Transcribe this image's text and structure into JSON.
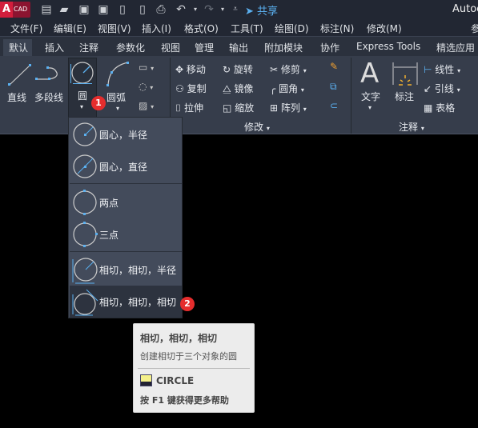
{
  "titlebar": {
    "logo": "CAD",
    "logo_letter": "A",
    "share": "共享",
    "app_title": "Autoc"
  },
  "menu": [
    "文件(F)",
    "编辑(E)",
    "视图(V)",
    "插入(I)",
    "格式(O)",
    "工具(T)",
    "绘图(D)",
    "标注(N)",
    "修改(M)",
    "参"
  ],
  "tabs": [
    "默认",
    "插入",
    "注释",
    "参数化",
    "视图",
    "管理",
    "输出",
    "附加模块",
    "协作",
    "Express Tools",
    "精选应用"
  ],
  "draw": {
    "line": "直线",
    "polyline": "多段线",
    "circle": "圆",
    "arc": "圆弧"
  },
  "modify": {
    "move": "移动",
    "rotate": "旋转",
    "trim": "修剪",
    "copy": "复制",
    "mirror": "镜像",
    "fillet": "圆角",
    "stretch": "拉伸",
    "scale": "缩放",
    "array": "阵列",
    "title": "修改"
  },
  "annotation": {
    "text": "文字",
    "dimension": "标注",
    "linear": "线性",
    "leader": "引线",
    "table": "表格",
    "title": "注释"
  },
  "badges": [
    "1",
    "2"
  ],
  "circle_menu": [
    "圆心，半径",
    "圆心，直径",
    "两点",
    "三点",
    "相切，相切，半径",
    "相切，相切，相切"
  ],
  "tooltip": {
    "title": "相切，相切，相切",
    "desc": "创建相切于三个对象的圆",
    "command": "CIRCLE",
    "help": "按 F1 键获得更多帮助"
  },
  "colors": {
    "accent": "#5bb0f0",
    "badge": "#e52d2d",
    "ribbon": "#363d4b"
  }
}
